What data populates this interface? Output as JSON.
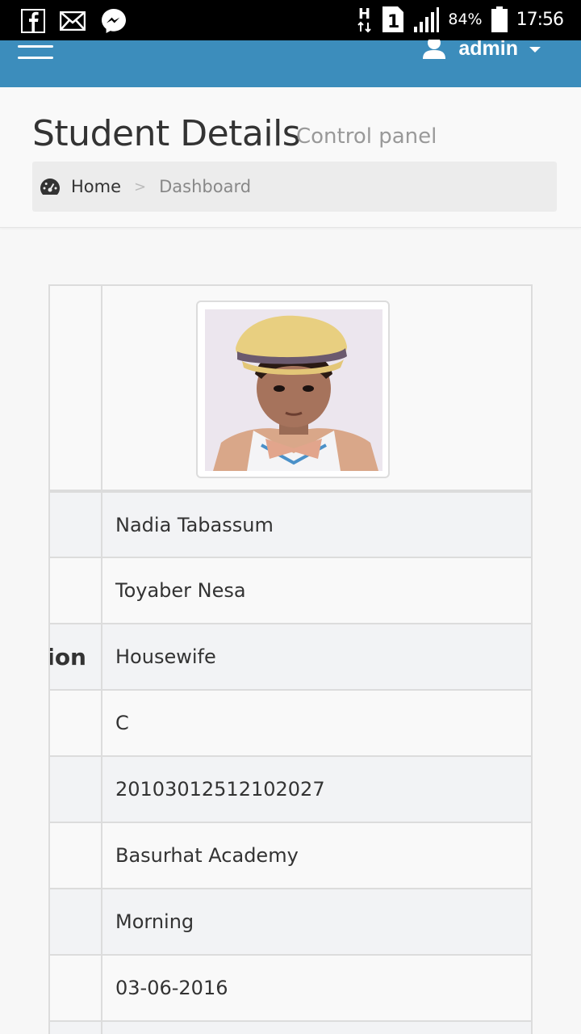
{
  "status_bar": {
    "battery": "84%",
    "time": "17:56",
    "network": "H",
    "sim": "1",
    "left_icons": [
      "facebook-icon",
      "mail-icon",
      "messenger-icon"
    ]
  },
  "header": {
    "user_label": "admin",
    "accent": "#3c8dbc"
  },
  "page": {
    "title": "Student Details",
    "subtitle": "Control panel"
  },
  "breadcrumb": {
    "home": "Home",
    "separator": ">",
    "current": "Dashboard"
  },
  "details": {
    "rows": [
      {
        "label": "",
        "value": "Nadia Tabassum"
      },
      {
        "label": "",
        "value": "Toyaber Nesa"
      },
      {
        "label": "ion",
        "value": "Housewife"
      },
      {
        "label": "",
        "value": "C"
      },
      {
        "label": "",
        "value": "20103012512102027"
      },
      {
        "label": "",
        "value": "Basurhat Academy"
      },
      {
        "label": "",
        "value": "Morning"
      },
      {
        "label": "",
        "value": "03-06-2016"
      }
    ]
  }
}
